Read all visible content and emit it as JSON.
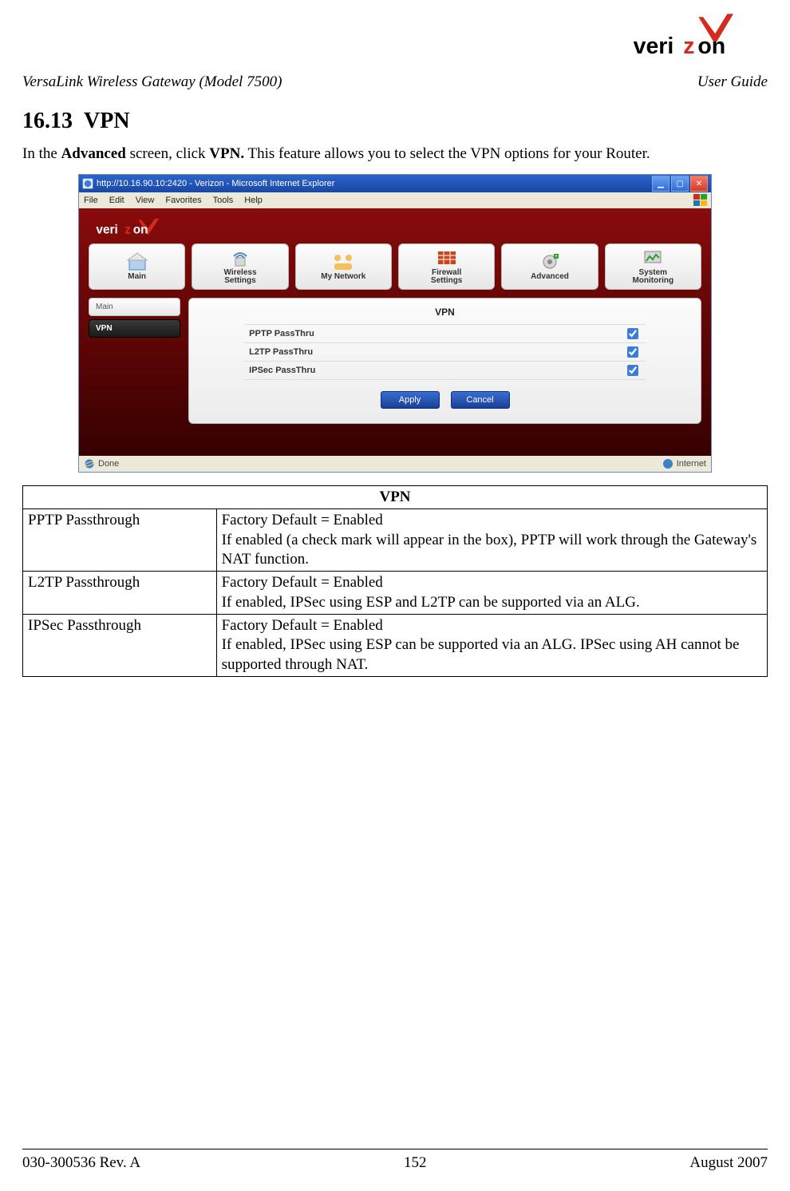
{
  "header": {
    "left": "VersaLink Wireless Gateway (Model 7500)",
    "right": "User Guide"
  },
  "section": {
    "number": "16.13",
    "title": "VPN"
  },
  "intro": {
    "prefix": "In the ",
    "bold1": "Advanced",
    "mid": " screen, click ",
    "bold2": "VPN.",
    "suffix": " This feature allows you to select the VPN options for your Router."
  },
  "screenshot": {
    "window_title": "http://10.16.90.10:2420 - Verizon - Microsoft Internet Explorer",
    "menubar": [
      "File",
      "Edit",
      "View",
      "Favorites",
      "Tools",
      "Help"
    ],
    "brand": "verizon",
    "nav": [
      {
        "label": "Main",
        "icon": "home-icon"
      },
      {
        "label": "Wireless\nSettings",
        "icon": "wireless-icon"
      },
      {
        "label": "My Network",
        "icon": "network-icon"
      },
      {
        "label": "Firewall\nSettings",
        "icon": "firewall-icon"
      },
      {
        "label": "Advanced",
        "icon": "advanced-icon"
      },
      {
        "label": "System\nMonitoring",
        "icon": "monitoring-icon"
      }
    ],
    "sidebar": [
      {
        "label": "Main",
        "active": false
      },
      {
        "label": "VPN",
        "active": true
      }
    ],
    "panel_title": "VPN",
    "rows": [
      {
        "label": "PPTP PassThru",
        "checked": true
      },
      {
        "label": "L2TP PassThru",
        "checked": true
      },
      {
        "label": "IPSec PassThru",
        "checked": true
      }
    ],
    "buttons": {
      "apply": "Apply",
      "cancel": "Cancel"
    },
    "status_left": "Done",
    "status_right": "Internet"
  },
  "vpn_table": {
    "title": "VPN",
    "rows": [
      {
        "name": "PPTP Passthrough",
        "default": "Factory Default = Enabled",
        "desc": "If enabled (a check mark will appear in the box), PPTP will work through the Gateway's NAT function."
      },
      {
        "name": "L2TP Passthrough",
        "default": "Factory Default = Enabled",
        "desc": "If enabled, IPSec using ESP and L2TP can be supported via an ALG."
      },
      {
        "name": "IPSec Passthrough",
        "default": "Factory Default = Enabled",
        "desc": "If enabled, IPSec using ESP can be supported via an ALG. IPSec using AH cannot be supported through NAT."
      }
    ]
  },
  "footer": {
    "left": "030-300536 Rev. A",
    "center": "152",
    "right": "August 2007"
  }
}
